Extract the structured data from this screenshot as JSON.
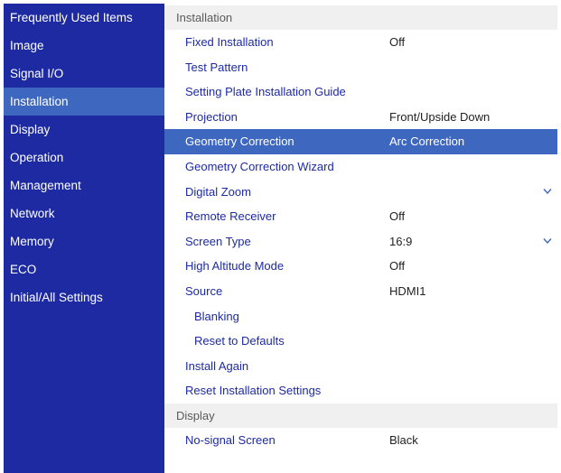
{
  "sidebar": {
    "items": [
      {
        "label": "Frequently Used Items"
      },
      {
        "label": "Image"
      },
      {
        "label": "Signal I/O"
      },
      {
        "label": "Installation"
      },
      {
        "label": "Display"
      },
      {
        "label": "Operation"
      },
      {
        "label": "Management"
      },
      {
        "label": "Network"
      },
      {
        "label": "Memory"
      },
      {
        "label": "ECO"
      },
      {
        "label": "Initial/All Settings"
      }
    ],
    "active_index": 3
  },
  "installation": {
    "header": "Installation",
    "rows": [
      {
        "label": "Fixed Installation",
        "value": "Off"
      },
      {
        "label": "Test Pattern",
        "value": ""
      },
      {
        "label": "Setting Plate Installation Guide",
        "value": ""
      },
      {
        "label": "Projection",
        "value": "Front/Upside Down"
      },
      {
        "label": "Geometry Correction",
        "value": "Arc Correction"
      },
      {
        "label": "Geometry Correction Wizard",
        "value": ""
      },
      {
        "label": "Digital Zoom",
        "value": "",
        "icon": "chevron-down-icon"
      },
      {
        "label": "Remote Receiver",
        "value": "Off"
      },
      {
        "label": "Screen Type",
        "value": "16:9",
        "icon": "chevron-down-icon"
      },
      {
        "label": "High Altitude Mode",
        "value": "Off"
      },
      {
        "label": "Source",
        "value": "HDMI1"
      },
      {
        "label": "Blanking",
        "value": ""
      },
      {
        "label": "Reset to Defaults",
        "value": ""
      },
      {
        "label": "Install Again",
        "value": ""
      },
      {
        "label": "Reset Installation Settings",
        "value": ""
      }
    ],
    "selected_index": 4
  },
  "display": {
    "header": "Display",
    "rows": [
      {
        "label": "No-signal Screen",
        "value": "Black"
      }
    ]
  },
  "colors": {
    "sidebar_bg": "#1d2aa2",
    "highlight": "#3e67bf",
    "item_text": "#1d2aa2",
    "value_text": "#222222",
    "header_bg": "#f0f0f0",
    "chevron": "#3e67bf"
  }
}
